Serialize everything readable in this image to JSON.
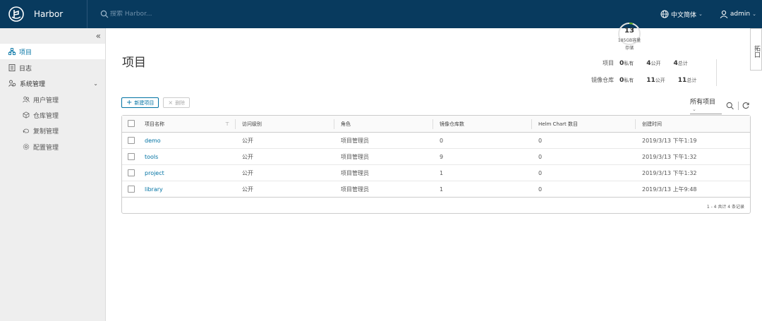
{
  "header": {
    "title": "Harbor",
    "search_placeholder": "搜索 Harbor...",
    "language": "中文简体",
    "user": "admin"
  },
  "sidebar": {
    "collapse_glyph": "«",
    "items": [
      {
        "label": "项目",
        "icon": "projects-icon",
        "active": true
      },
      {
        "label": "日志",
        "icon": "logs-icon"
      },
      {
        "label": "系统管理",
        "icon": "admin-icon",
        "expanded": true
      }
    ],
    "sub_items": [
      {
        "label": "用户管理",
        "icon": "users-icon"
      },
      {
        "label": "仓库管理",
        "icon": "registry-icon"
      },
      {
        "label": "复制管理",
        "icon": "replication-icon"
      },
      {
        "label": "配置管理",
        "icon": "config-icon"
      }
    ]
  },
  "main": {
    "title": "项目",
    "stats": {
      "projects_label": "项目",
      "repos_label": "镜像仓库",
      "private_unit": "私有",
      "public_unit": "公开",
      "total_unit": "总计",
      "projects": {
        "private": "0",
        "public": "4",
        "total": "4"
      },
      "repos": {
        "private": "0",
        "public": "11",
        "total": "11"
      }
    },
    "storage": {
      "count": "13",
      "capacity": "185GB容量",
      "label": "存储",
      "used_fraction": 0.05
    },
    "side_tab": "拓口"
  },
  "toolbar": {
    "new_project": "新建项目",
    "delete": "删除",
    "filter_label": "所有项目"
  },
  "table": {
    "columns": [
      "项目名称",
      "访问级别",
      "角色",
      "镜像仓库数",
      "Helm Chart 数目",
      "创建时间"
    ],
    "rows": [
      {
        "name": "demo",
        "access": "公开",
        "role": "项目管理员",
        "repos": "0",
        "charts": "0",
        "created": "2019/3/13 下午1:19"
      },
      {
        "name": "tools",
        "access": "公开",
        "role": "项目管理员",
        "repos": "9",
        "charts": "0",
        "created": "2019/3/13 下午1:32"
      },
      {
        "name": "project",
        "access": "公开",
        "role": "项目管理员",
        "repos": "1",
        "charts": "0",
        "created": "2019/3/13 下午1:32"
      },
      {
        "name": "library",
        "access": "公开",
        "role": "项目管理员",
        "repos": "1",
        "charts": "0",
        "created": "2019/3/13 上午9:48"
      }
    ],
    "footer": "1 - 4 共计 4 条记录"
  },
  "colors": {
    "header_bg": "#083a5e",
    "link": "#0072a3",
    "sidebar_bg": "#eeeeee"
  }
}
